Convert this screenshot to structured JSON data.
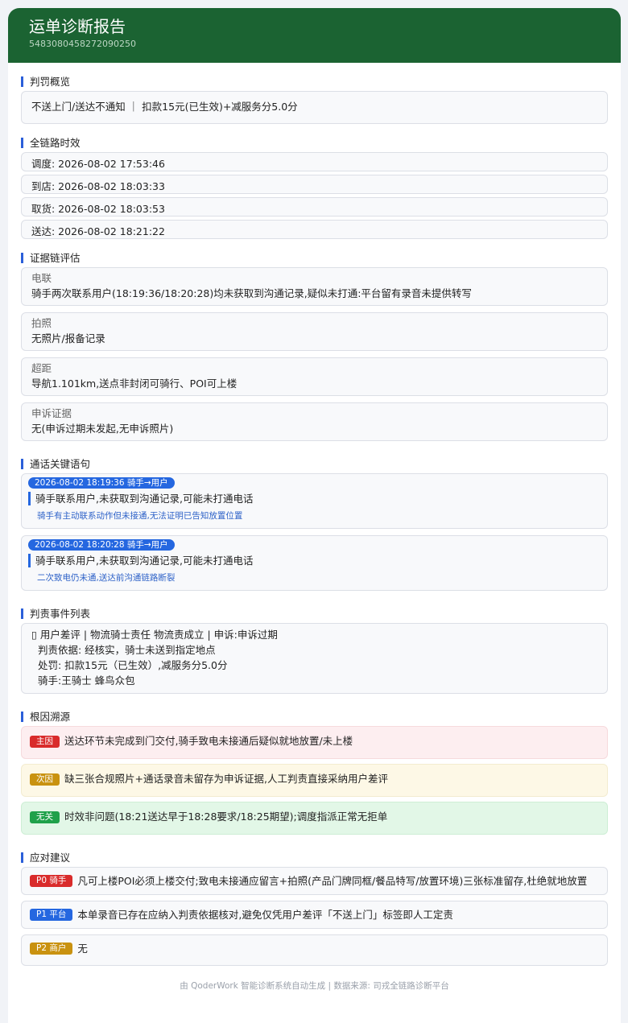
{
  "header": {
    "title": "运单诊断报告",
    "order_id": "5483080458272090250",
    "bg_color": "#1b6332"
  },
  "overview": {
    "section_title": "判罚概览",
    "summary": "不送上门/送达不通知 ｜ 扣款15元(已生效)+减服务分5.0分"
  },
  "timeline": {
    "section_title": "全链路时效",
    "rows": [
      "调度: 2026-08-02 17:53:46",
      "到店: 2026-08-02 18:03:33",
      "取货: 2026-08-02 18:03:53",
      "送达: 2026-08-02 18:21:22"
    ]
  },
  "evidence": {
    "section_title": "证据链评估",
    "items": [
      {
        "label": "电联",
        "text": "骑手两次联系用户(18:19:36/18:20:28)均未获取到沟通记录,疑似未打通:平台留有录音未提供转写"
      },
      {
        "label": "拍照",
        "text": "无照片/报备记录"
      },
      {
        "label": "超距",
        "text": "导航1.101km,送点非封闭可骑行、POI可上楼"
      },
      {
        "label": "申诉证据",
        "text": "无(申诉过期未发起,无申诉照片)"
      }
    ]
  },
  "calls": {
    "section_title": "通话关键语句",
    "items": [
      {
        "tag": "2026-08-02 18:19:36  骑手→用户",
        "main": "骑手联系用户,未获取到沟通记录,可能未打通电话",
        "note": "骑手有主动联系动作但未接通,无法证明已告知放置位置"
      },
      {
        "tag": "2026-08-02 18:20:28  骑手→用户",
        "main": "骑手联系用户,未获取到沟通记录,可能未打通电话",
        "note": "二次致电仍未通,送达前沟通链路断裂"
      }
    ]
  },
  "events": {
    "section_title": "判责事件列表",
    "line1": "▯ 用户差评 | 物流骑士责任 物流责成立 | 申诉:申诉过期",
    "line2": "判责依据: 经核实，骑士未送到指定地点",
    "line3": "处罚: 扣款15元（已生效）,减服务分5.0分",
    "line4": "骑手:王骑士 蜂鸟众包"
  },
  "causes": {
    "section_title": "根因溯源",
    "items": [
      {
        "badge": "主因",
        "text": "送达环节未完成到门交付,骑手致电未接通后疑似就地放置/未上楼"
      },
      {
        "badge": "次因",
        "text": "缺三张合规照片+通话录音未留存为申诉证据,人工判责直接采纳用户差评"
      },
      {
        "badge": "无关",
        "text": "时效非问题(18:21送达早于18:28要求/18:25期望);调度指派正常无拒单"
      }
    ]
  },
  "suggestions": {
    "section_title": "应对建议",
    "items": [
      {
        "badge": "P0 骑手",
        "text": "凡可上楼POI必须上楼交付;致电未接通应留言+拍照(产品门牌同框/餐品特写/放置环境)三张标准留存,杜绝就地放置"
      },
      {
        "badge": "P1 平台",
        "text": "本单录音已存在应纳入判责依据核对,避免仅凭用户差评「不送上门」标签即人工定责"
      },
      {
        "badge": "P2 商户",
        "text": "无"
      }
    ]
  },
  "footer": {
    "text": "由 QoderWork 智能诊断系统自动生成 | 数据来源: 司戎全链路诊断平台"
  }
}
